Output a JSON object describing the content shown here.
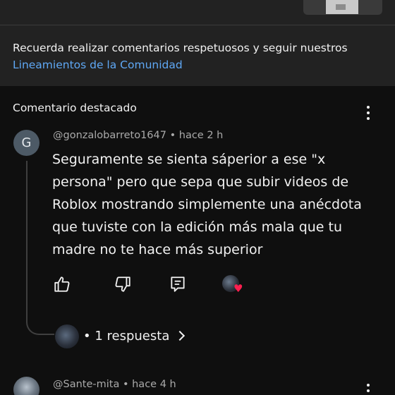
{
  "notice": {
    "text": "Recuerda realizar comentarios respetuosos y seguir nuestros",
    "link": "Lineamientos de la Comunidad"
  },
  "section": {
    "title": "Comentario destacado"
  },
  "comment": {
    "avatar_letter": "G",
    "meta": "@gonzalobarreto1647 • hace 2 h",
    "body": "Seguramente se sienta sáperior a ese \"x persona\" pero que sepa que subir videos de Roblox mostrando simplemente una anécdota que tuviste con la edición más mala que tu madre no te hace más superior",
    "replies_label": "• 1 respuesta"
  },
  "next_comment": {
    "meta": "@Sante-mita • hace 4 h"
  },
  "icons": {
    "like": "thumbs-up-icon",
    "dislike": "thumbs-down-icon",
    "reply": "comment-icon",
    "creator_heart": "heart-icon",
    "more": "kebab-menu-icon",
    "heart_color": "#ff1f4f",
    "link_color": "#5fa8f5"
  }
}
